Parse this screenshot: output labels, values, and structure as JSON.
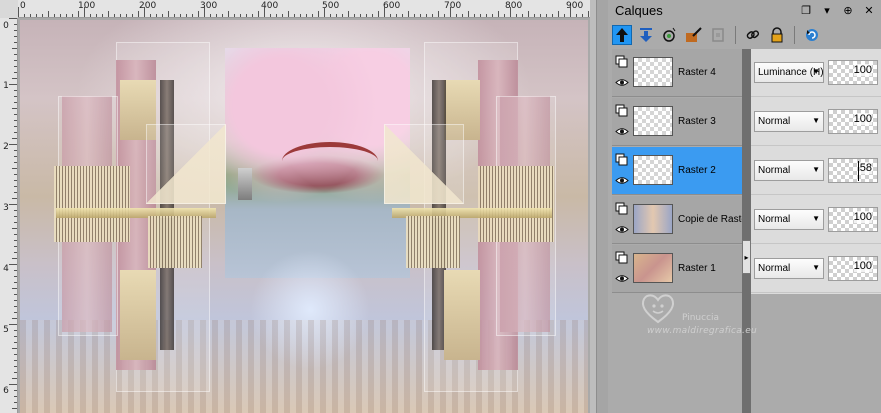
{
  "rulers": {
    "horizontal": [
      "0",
      "100",
      "200",
      "300",
      "400",
      "500",
      "600",
      "700",
      "800",
      "900"
    ],
    "vertical": [
      "0",
      "1",
      "2",
      "3",
      "4",
      "5",
      "6"
    ]
  },
  "palette": {
    "title": "Calques",
    "title_buttons": [
      "❐",
      "▾",
      "⊕",
      "✕"
    ],
    "toolbar_icons": [
      "move-up-icon",
      "move-down-icon",
      "new-layer-icon",
      "edit-icon",
      "mask-icon",
      "link-icon",
      "lock-icon",
      "refresh-icon"
    ],
    "selected_color": "#3b9bf1"
  },
  "layers": [
    {
      "name": "Raster 4",
      "blend": "Luminance (H)",
      "opacity": "100",
      "selected": false,
      "thumb": "transparent"
    },
    {
      "name": "Raster 3",
      "blend": "Normal",
      "opacity": "100",
      "selected": false,
      "thumb": "transparent"
    },
    {
      "name": "Raster 2",
      "blend": "Normal",
      "opacity": "58",
      "selected": true,
      "thumb": "transparent"
    },
    {
      "name": "Copie de Raster",
      "blend": "Normal",
      "opacity": "100",
      "selected": false,
      "thumb": "image"
    },
    {
      "name": "Raster 1",
      "blend": "Normal",
      "opacity": "100",
      "selected": false,
      "thumb": "gradient"
    }
  ],
  "watermark": {
    "name": "Pinuccia",
    "url": "www.maldiregrafica.eu"
  }
}
